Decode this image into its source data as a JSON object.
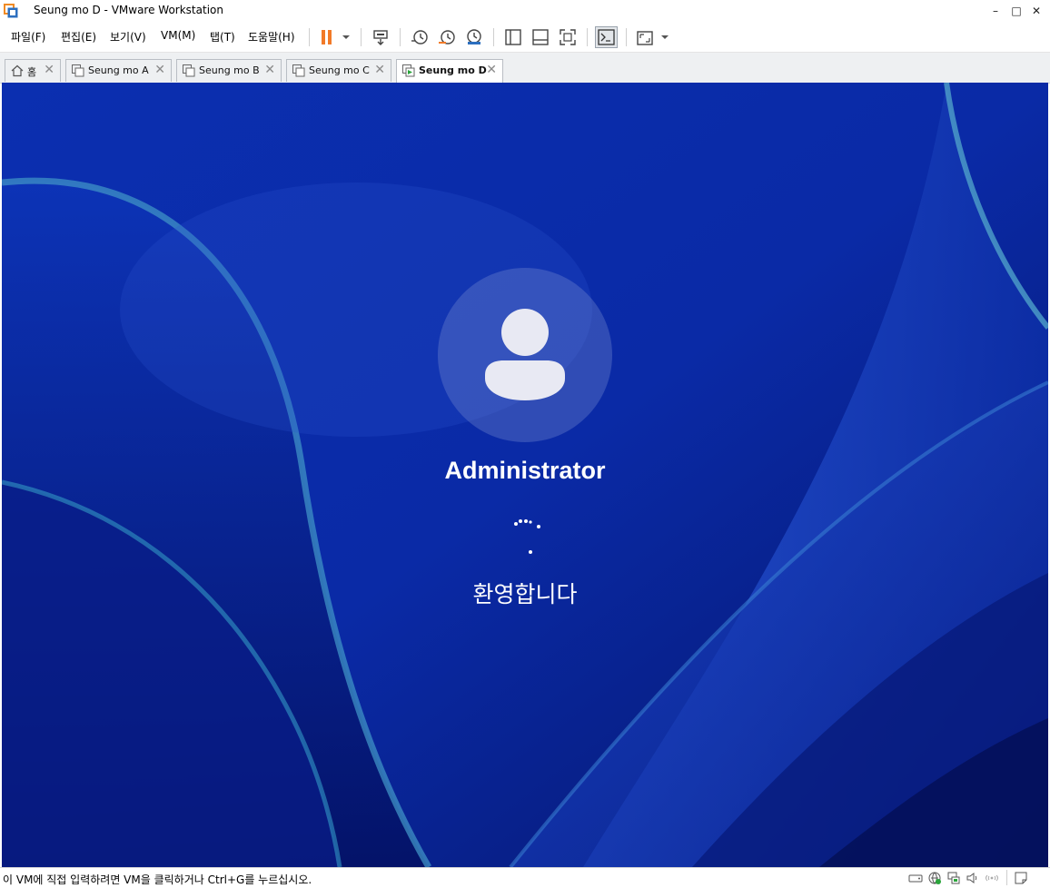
{
  "window": {
    "title": "Seung mo D - VMware Workstation",
    "minimize": "–",
    "maximize": "□",
    "close": "✕"
  },
  "menu": {
    "items": [
      "파일(F)",
      "편집(E)",
      "보기(V)",
      "VM(M)",
      "탭(T)",
      "도움말(H)"
    ]
  },
  "tabs": [
    {
      "label": "홈",
      "active": false
    },
    {
      "label": "Seung mo A",
      "active": false
    },
    {
      "label": "Seung mo B",
      "active": false
    },
    {
      "label": "Seung mo C",
      "active": false
    },
    {
      "label": "Seung mo D",
      "active": true
    }
  ],
  "tab_close_glyph": "✕",
  "lockscreen": {
    "user_name": "Administrator",
    "welcome_text": "환영합니다"
  },
  "statusbar": {
    "hint": "이 VM에 직접 입력하려면 VM을 클릭하거나 Ctrl+G를 누르십시오."
  },
  "colors": {
    "pause_accent": "#f27a28",
    "wallpaper_base": "#0a2aa0"
  },
  "icons": {
    "app": "vmware-logo-icon",
    "toolbar": [
      "pause-icon",
      "send-ctrl-alt-del-icon",
      "snapshot-icon",
      "revert-snapshot-icon",
      "snapshot-manager-icon",
      "library-icon",
      "thumbnail-bar-icon",
      "full-screen-icon",
      "console-icon",
      "unity-icon"
    ],
    "status": [
      "hdd-icon",
      "network-icon",
      "usb-icon",
      "sound-icon",
      "message-icon"
    ]
  }
}
